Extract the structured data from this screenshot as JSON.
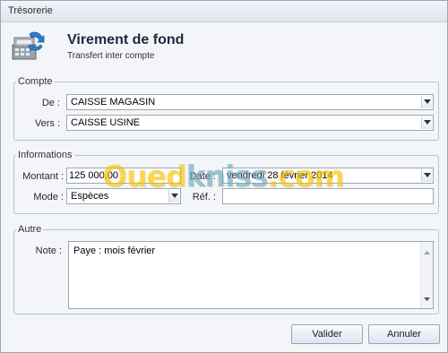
{
  "window": {
    "title": "Trésorerie"
  },
  "header": {
    "icon": "cash-register-transfer-icon",
    "title": "Virement de fond",
    "subtitle": "Transfert inter compte"
  },
  "compte": {
    "legend": "Compte",
    "de_label": "De :",
    "de_value": "CAISSE MAGASIN",
    "vers_label": "Vers :",
    "vers_value": "CAISSE USINE"
  },
  "informations": {
    "legend": "Informations",
    "montant_label": "Montant :",
    "montant_value": "125 000,00",
    "date_label": "Date :",
    "date_value": "vendredi 28 février 2014",
    "mode_label": "Mode :",
    "mode_value": "Espèces",
    "ref_label": "Réf. :",
    "ref_value": ""
  },
  "autre": {
    "legend": "Autre",
    "note_label": "Note :",
    "note_value": "Paye : mois février"
  },
  "buttons": {
    "valider": "Valider",
    "annuler": "Annuler"
  },
  "watermark": {
    "part1": "Oued",
    "part2": "kniss",
    "part3": ".com"
  }
}
